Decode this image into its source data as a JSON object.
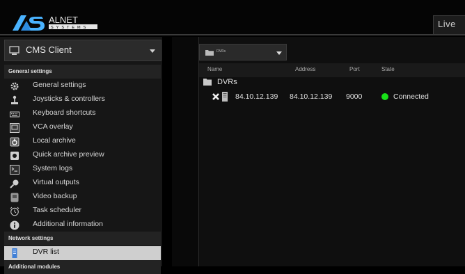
{
  "header": {
    "logo_text": "ALNET",
    "logo_subtext": "SYSTEMS",
    "live_tab": "Live"
  },
  "sidebar": {
    "client_select": "CMS Client",
    "sections": [
      {
        "title": "General settings"
      },
      {
        "title": "Network settings"
      },
      {
        "title": "Additional modules"
      }
    ],
    "items": [
      {
        "label": "General settings",
        "icon": "gear-icon"
      },
      {
        "label": "Joysticks & controllers",
        "icon": "joystick-icon"
      },
      {
        "label": "Keyboard shortcuts",
        "icon": "keyboard-icon"
      },
      {
        "label": "VCA overlay",
        "icon": "vca-overlay-icon"
      },
      {
        "label": "Local archive",
        "icon": "local-archive-icon"
      },
      {
        "label": "Quick archive preview",
        "icon": "archive-preview-icon"
      },
      {
        "label": "System logs",
        "icon": "logs-icon"
      },
      {
        "label": "Virtual outputs",
        "icon": "virtual-outputs-icon"
      },
      {
        "label": "Video backup",
        "icon": "video-backup-icon"
      },
      {
        "label": "Task scheduler",
        "icon": "clock-icon"
      },
      {
        "label": "Additional information",
        "icon": "info-icon"
      },
      {
        "label": "DVR list",
        "icon": "server-icon",
        "active": true
      }
    ]
  },
  "main": {
    "dvr_select": "DVRs",
    "columns": [
      "Name",
      "Address",
      "Port",
      "State"
    ],
    "group": "DVRs",
    "rows": [
      {
        "name": "84.10.12.139",
        "address": "84.10.12.139",
        "port": "9000",
        "state": "Connected",
        "state_color": "#18e018"
      }
    ]
  }
}
